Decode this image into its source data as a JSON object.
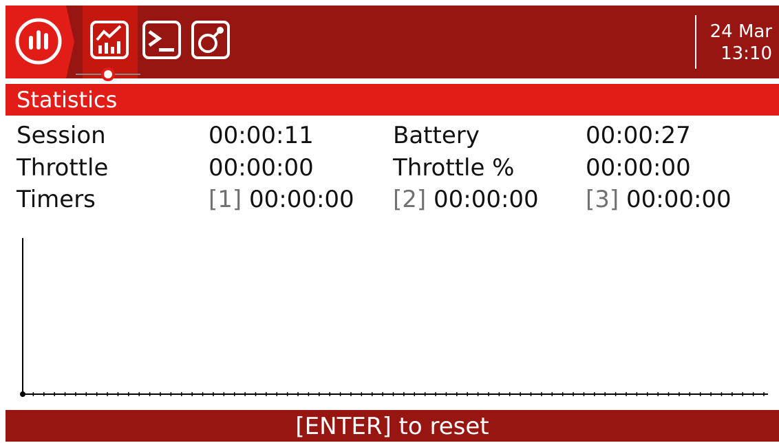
{
  "header": {
    "clock_date": "24 Mar",
    "clock_time": "13:10",
    "icons": [
      "radio-menu-icon",
      "statistics-chart-icon",
      "terminal-icon",
      "stick-check-icon"
    ]
  },
  "page": {
    "title": "Statistics"
  },
  "stats": {
    "session_label": "Session",
    "session_value": "00:00:11",
    "battery_label": "Battery",
    "battery_value": "00:00:27",
    "throttle_label": "Throttle",
    "throttle_value": "00:00:00",
    "throttle_pct_label": "Throttle %",
    "throttle_pct_value": "00:00:00",
    "timers_label": "Timers",
    "timers": [
      {
        "index": "[1]",
        "value": "00:00:00"
      },
      {
        "index": "[2]",
        "value": "00:00:00"
      },
      {
        "index": "[3]",
        "value": "00:00:00"
      }
    ]
  },
  "chart_data": {
    "type": "line",
    "title": "",
    "xlabel": "",
    "ylabel": "",
    "x_ticks": 70,
    "series": [
      {
        "values": []
      }
    ]
  },
  "footer": {
    "label": "[ENTER] to reset"
  },
  "colors": {
    "header_bg": "#981611",
    "active_tab_bg": "#c4180f",
    "title_bar": "#e21d18",
    "footer_bg": "#981611",
    "text": "#111111",
    "muted_text": "#707070"
  }
}
